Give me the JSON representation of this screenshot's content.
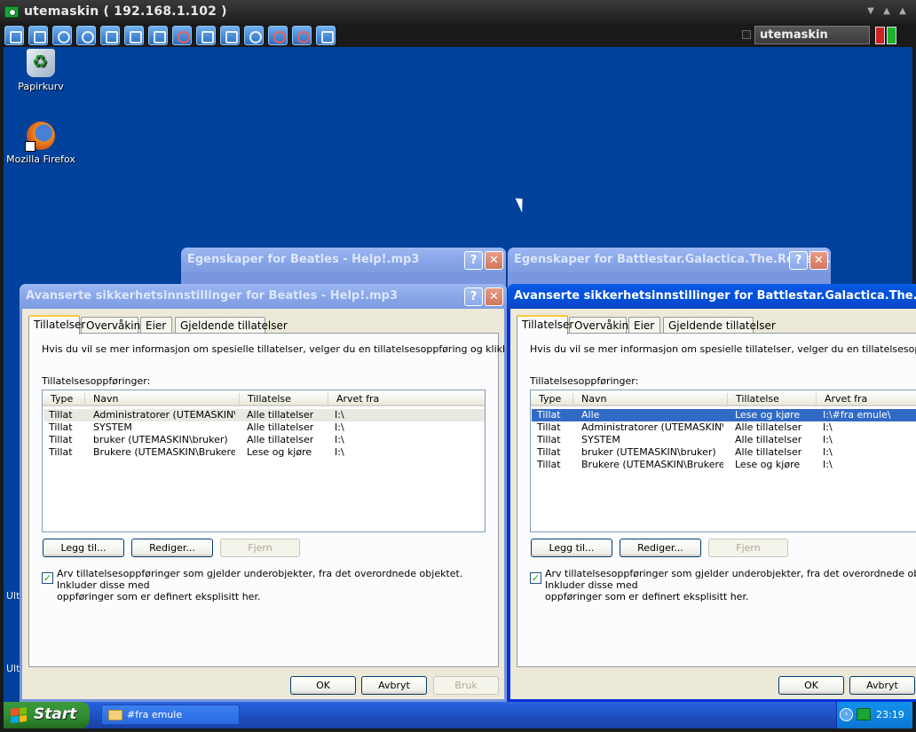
{
  "viewer": {
    "title": "utemaskin ( 192.168.1.102 )",
    "host_field": "utemaskin",
    "colors": {
      "red": "#cc2222",
      "green": "#1db12d"
    }
  },
  "desktop": {
    "icons": [
      {
        "label": "Papirkurv"
      },
      {
        "label": "Mozilla Firefox"
      }
    ],
    "side_labels": [
      "Ult",
      "Ult"
    ],
    "background": "#00419c"
  },
  "left_props": {
    "title": "Egenskaper for Beatles - Help!.mp3"
  },
  "right_props": {
    "title": "Egenskaper for Battlestar.Galactica.The.Resist..."
  },
  "left_adv": {
    "title": "Avanserte sikkerhetsinnstillinger for Beatles - Help!.mp3",
    "tabs": [
      "Tillatelser",
      "Overvåking",
      "Eier",
      "Gjeldende tillatelser"
    ],
    "info": "Hvis du vil se mer informasjon om spesielle tillatelser, velger du en tillatelsesoppføring og klikker Rediger.",
    "list_label": "Tillatelsesoppføringer:",
    "columns": [
      "Type",
      "Navn",
      "Tillatelse",
      "Arvet fra"
    ],
    "rows": [
      [
        "Tillat",
        "Administratorer (UTEMASKIN\\A...",
        "Alle tillatelser",
        "I:\\"
      ],
      [
        "Tillat",
        "SYSTEM",
        "Alle tillatelser",
        "I:\\"
      ],
      [
        "Tillat",
        "bruker (UTEMASKIN\\bruker)",
        "Alle tillatelser",
        "I:\\"
      ],
      [
        "Tillat",
        "Brukere (UTEMASKIN\\Brukere)",
        "Lese og kjøre",
        "I:\\"
      ]
    ],
    "buttons": {
      "add": "Legg til...",
      "edit": "Rediger...",
      "remove": "Fjern"
    },
    "inherit_text_1": "Arv tillatelsesoppføringer som gjelder underobjekter, fra det overordnede objektet. Inkluder disse med",
    "inherit_text_2": "oppføringer som er definert eksplisitt her.",
    "footer": {
      "ok": "OK",
      "cancel": "Avbryt",
      "apply": "Bruk"
    }
  },
  "right_adv": {
    "title": "Avanserte sikkerhetsinnstillinger for Battlestar.Galactica.The.Resistance",
    "tabs": [
      "Tillatelser",
      "Overvåking",
      "Eier",
      "Gjeldende tillatelser"
    ],
    "info": "Hvis du vil se mer informasjon om spesielle tillatelser, velger du en tillatelsesoppføring og klikker Rediger.",
    "list_label": "Tillatelsesoppføringer:",
    "columns": [
      "Type",
      "Navn",
      "Tillatelse",
      "Arvet fra"
    ],
    "rows": [
      [
        "Tillat",
        "Alle",
        "Lese og kjøre",
        "I:\\#fra emule\\"
      ],
      [
        "Tillat",
        "Administratorer (UTEMASKIN\\A...",
        "Alle tillatelser",
        "I:\\"
      ],
      [
        "Tillat",
        "SYSTEM",
        "Alle tillatelser",
        "I:\\"
      ],
      [
        "Tillat",
        "bruker (UTEMASKIN\\bruker)",
        "Alle tillatelser",
        "I:\\"
      ],
      [
        "Tillat",
        "Brukere (UTEMASKIN\\Brukere)",
        "Lese og kjøre",
        "I:\\"
      ]
    ],
    "buttons": {
      "add": "Legg til...",
      "edit": "Rediger...",
      "remove": "Fjern"
    },
    "inherit_text_1": "Arv tillatelsesoppføringer som gjelder underobjekter, fra det overordnede objektet. Inkluder disse med",
    "inherit_text_2": "oppføringer som er definert eksplisitt her.",
    "footer": {
      "ok": "OK",
      "cancel": "Avbryt"
    }
  },
  "taskbar": {
    "start_label": "Start",
    "task_label": "#fra emule",
    "clock": "23:19"
  }
}
